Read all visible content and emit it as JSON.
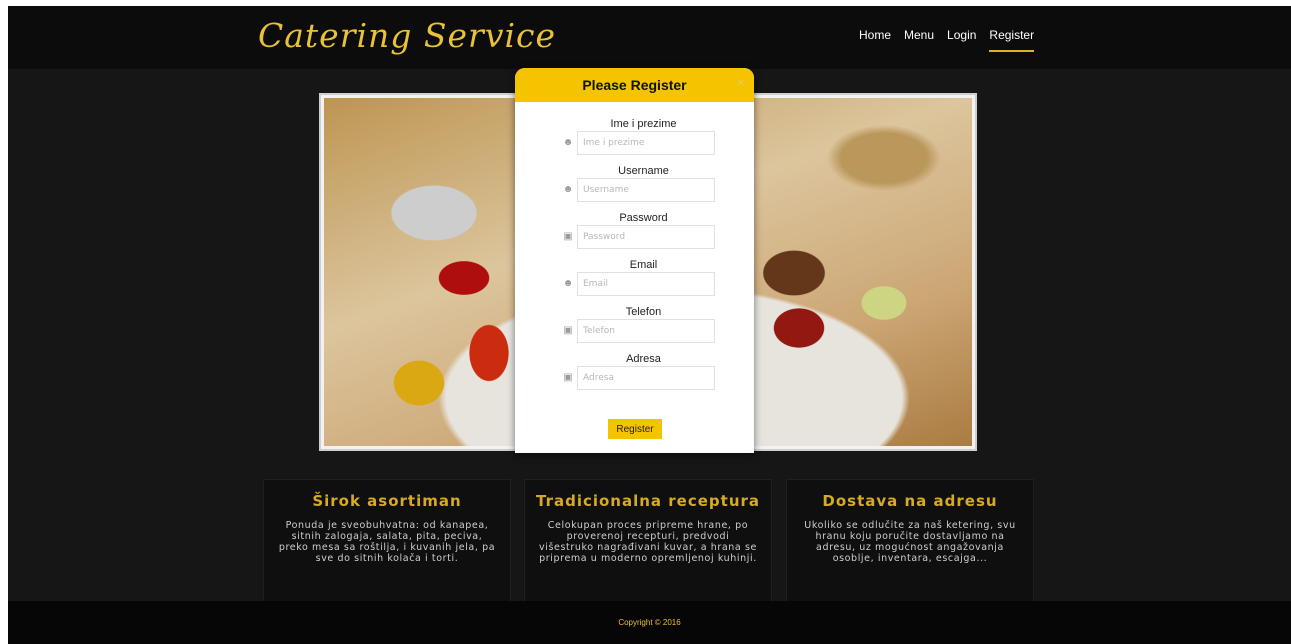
{
  "header": {
    "logo": "Catering Service",
    "nav": [
      "Home",
      "Menu",
      "Login",
      "Register"
    ],
    "active_nav": "Register"
  },
  "modal": {
    "title": "Please Register",
    "close_label": "×",
    "fields": [
      {
        "label": "Ime i prezime",
        "placeholder": "Ime i prezime",
        "icon": "user-icon"
      },
      {
        "label": "Username",
        "placeholder": "Username",
        "icon": "user-icon"
      },
      {
        "label": "Password",
        "placeholder": "Password",
        "icon": "lock-icon"
      },
      {
        "label": "Email",
        "placeholder": "Email",
        "icon": "user-icon"
      },
      {
        "label": "Telefon",
        "placeholder": "Telefon",
        "icon": "lock-icon"
      },
      {
        "label": "Adresa",
        "placeholder": "Adresa",
        "icon": "lock-icon"
      }
    ],
    "submit_label": "Register"
  },
  "cards": [
    {
      "title": "Širok asortiman",
      "text": "Ponuda je sveobuhvatna: od kanapea, sitnih zalogaja, salata, pita, peciva, preko mesa sa roštilja, i kuvanih jela, pa sve do sitnih kolača i torti."
    },
    {
      "title": "Tradicionalna receptura",
      "text": "Celokupan proces pripreme hrane, po proverenoj recepturi, predvodi višestruko nagrađivani kuvar, a hrana se priprema u moderno opremljenoj kuhinji."
    },
    {
      "title": "Dostava na adresu",
      "text": "Ukoliko se odlučite za naš ketering, svu hranu koju poručite dostavljamo na adresu, uz mogućnost angažovanja osoblje, inventara, escajga..."
    }
  ],
  "footer": {
    "copyright": "Copyright © 2016"
  },
  "colors": {
    "accent": "#f5c400",
    "gold_text": "#d6aa22",
    "background": "#161616"
  }
}
